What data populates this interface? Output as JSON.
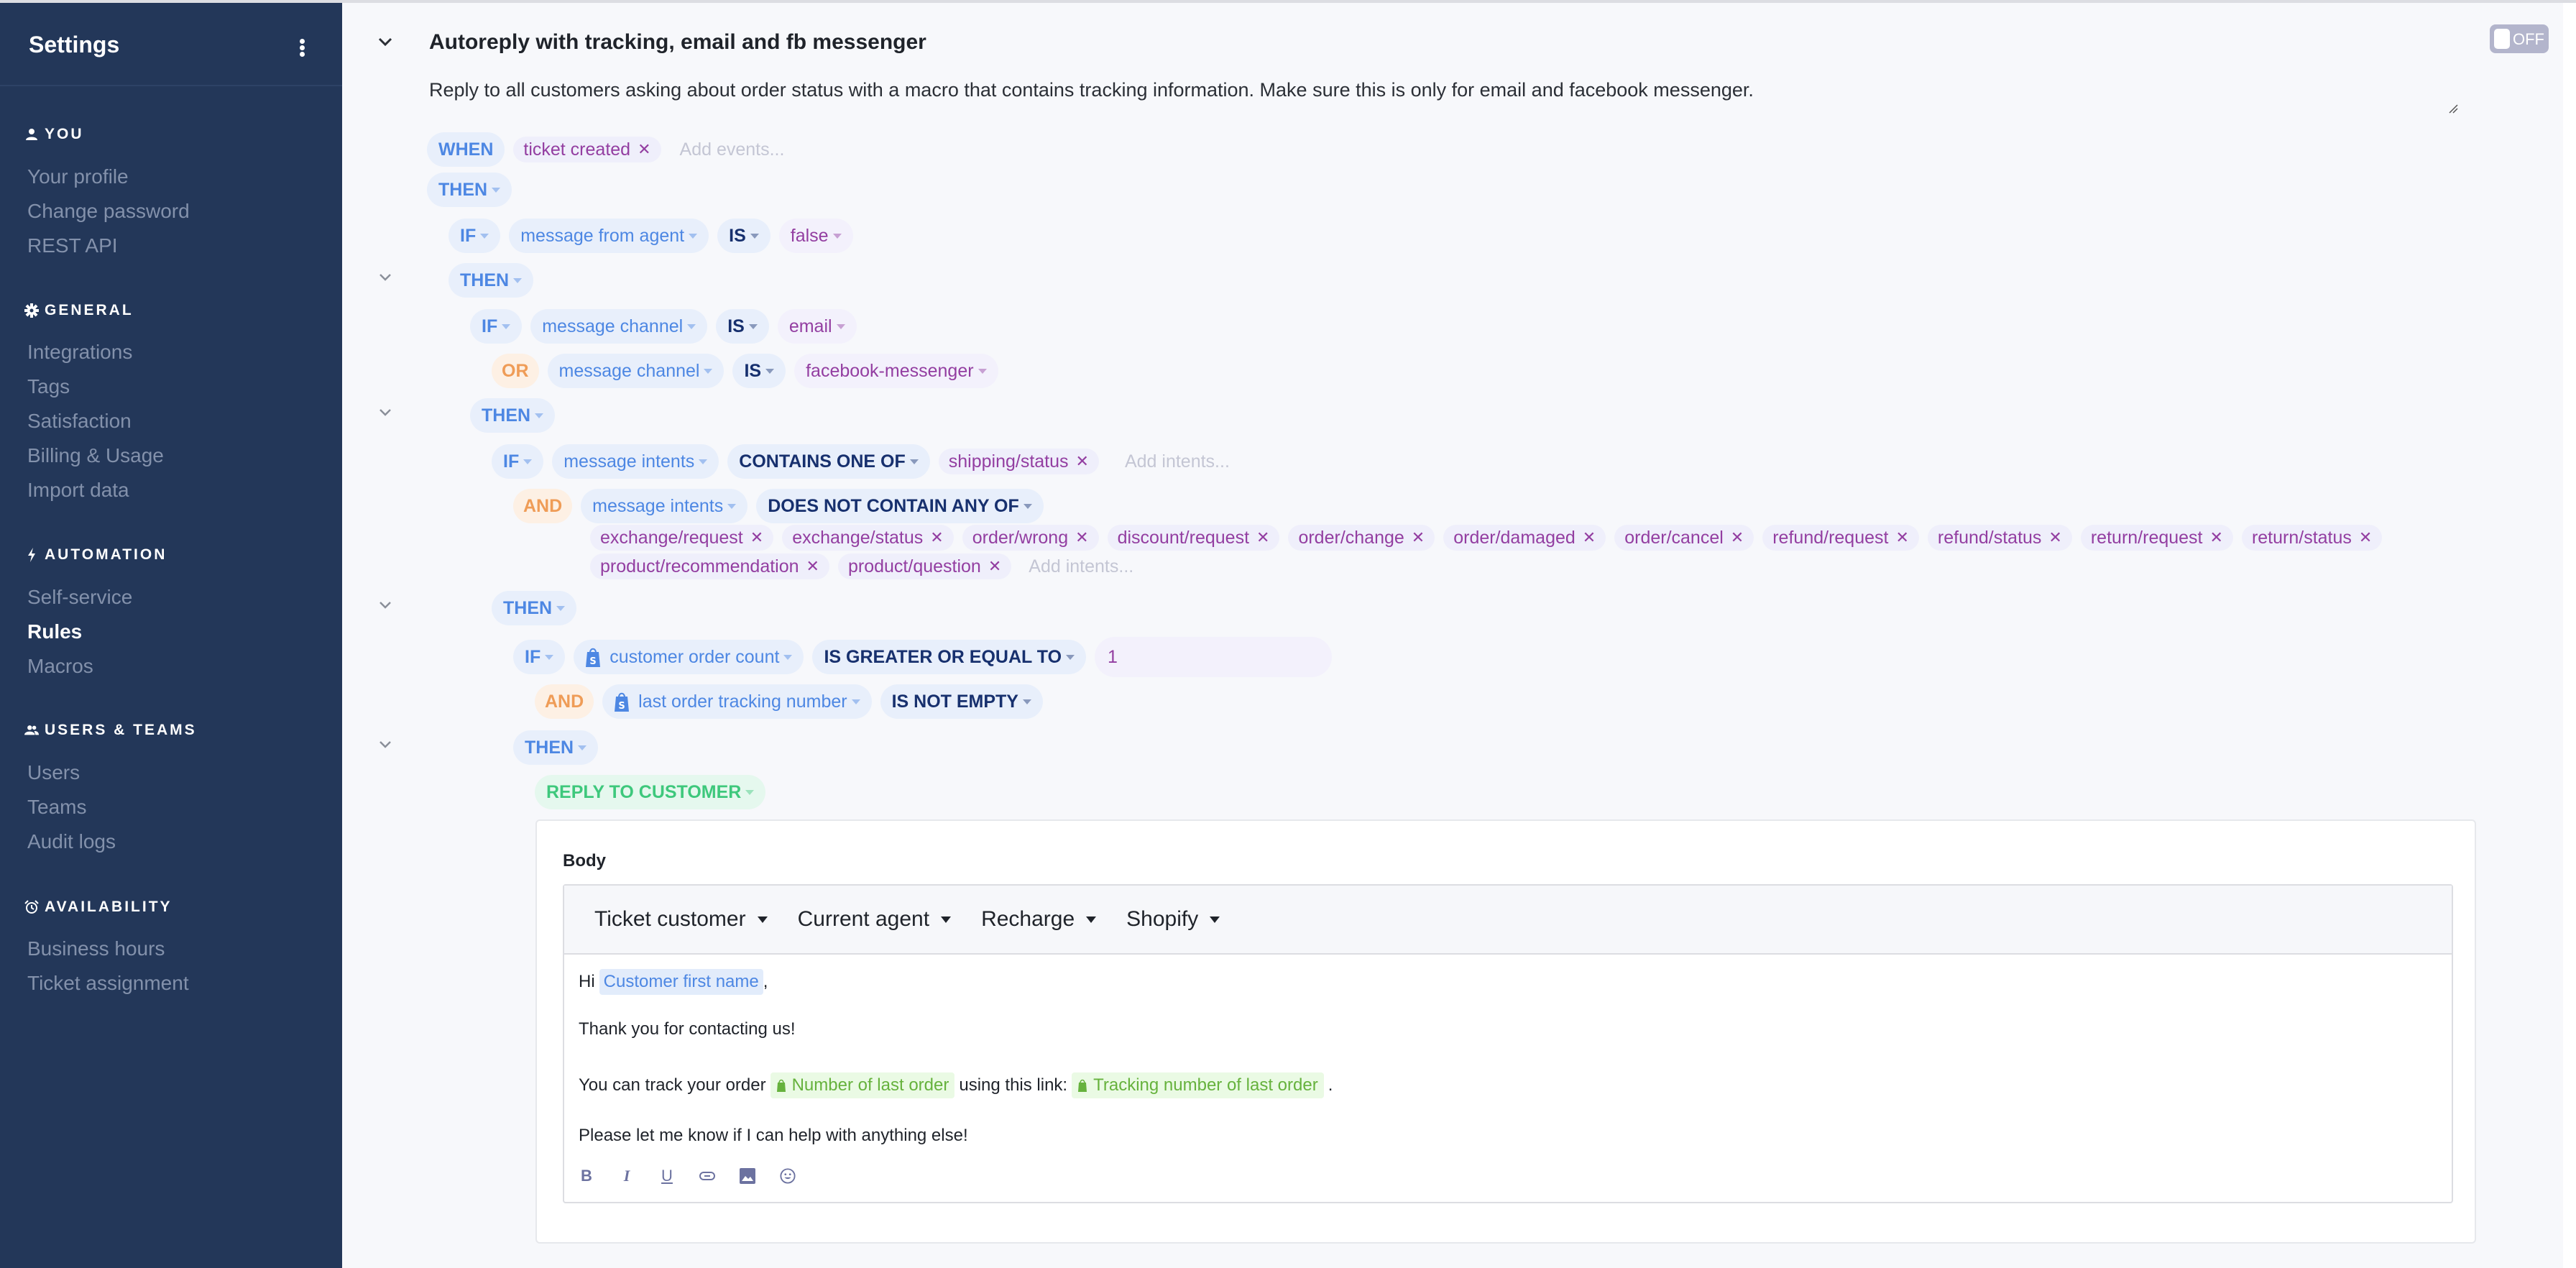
{
  "sidebar": {
    "title": "Settings",
    "menu_icon": "kebab-menu-icon",
    "sections": [
      {
        "heading": "YOU",
        "icon": "user-icon",
        "items": [
          {
            "label": "Your profile",
            "active": false
          },
          {
            "label": "Change password",
            "active": false
          },
          {
            "label": "REST API",
            "active": false
          }
        ]
      },
      {
        "heading": "GENERAL",
        "icon": "gear-icon",
        "items": [
          {
            "label": "Integrations",
            "active": false
          },
          {
            "label": "Tags",
            "active": false
          },
          {
            "label": "Satisfaction",
            "active": false
          },
          {
            "label": "Billing & Usage",
            "active": false
          },
          {
            "label": "Import data",
            "active": false
          }
        ]
      },
      {
        "heading": "AUTOMATION",
        "icon": "lightning-icon",
        "items": [
          {
            "label": "Self-service",
            "active": false
          },
          {
            "label": "Rules",
            "active": true
          },
          {
            "label": "Macros",
            "active": false
          }
        ]
      },
      {
        "heading": "USERS & TEAMS",
        "icon": "users-icon",
        "items": [
          {
            "label": "Users",
            "active": false
          },
          {
            "label": "Teams",
            "active": false
          },
          {
            "label": "Audit logs",
            "active": false
          }
        ]
      },
      {
        "heading": "AVAILABILITY",
        "icon": "alarm-clock-icon",
        "items": [
          {
            "label": "Business hours",
            "active": false
          },
          {
            "label": "Ticket assignment",
            "active": false
          }
        ]
      }
    ]
  },
  "rule": {
    "title": "Autoreply with tracking, email and fb messenger",
    "description": "Reply to all customers asking about order status with a macro that contains tracking information. Make sure this is only for email and facebook messenger.",
    "toggle_label": "OFF",
    "toggle_on": false,
    "when": {
      "keyword": "WHEN",
      "events": [
        "ticket created"
      ],
      "add_placeholder": "Add events..."
    },
    "then1": "THEN",
    "cond1": {
      "kw": "IF",
      "field": "message from agent",
      "op": "IS",
      "value": "false"
    },
    "then2": "THEN",
    "cond2": {
      "kw": "IF",
      "field": "message channel",
      "op": "IS",
      "value": "email"
    },
    "cond2b": {
      "kw": "OR",
      "field": "message channel",
      "op": "IS",
      "value": "facebook-messenger"
    },
    "then3": "THEN",
    "cond3": {
      "kw": "IF",
      "field": "message intents",
      "op": "CONTAINS ONE OF",
      "tags": [
        "shipping/status"
      ],
      "add_placeholder": "Add intents..."
    },
    "cond3b": {
      "kw": "AND",
      "field": "message intents",
      "op": "DOES NOT CONTAIN ANY OF",
      "tags": [
        "exchange/request",
        "exchange/status",
        "order/wrong",
        "discount/request",
        "order/change",
        "order/damaged",
        "order/cancel",
        "refund/request",
        "refund/status",
        "return/request",
        "return/status",
        "product/recommendation",
        "product/question"
      ],
      "add_placeholder": "Add intents..."
    },
    "then4": "THEN",
    "cond4": {
      "kw": "IF",
      "field": "customer order count",
      "op": "IS GREATER OR EQUAL TO",
      "value": "1"
    },
    "cond4b": {
      "kw": "AND",
      "field": "last order tracking number",
      "op": "IS NOT EMPTY"
    },
    "then5": "THEN",
    "action": "REPLY TO CUSTOMER",
    "body": {
      "label": "Body",
      "variable_menus": [
        "Ticket customer",
        "Current agent",
        "Recharge",
        "Shopify"
      ],
      "line1_prefix": "Hi",
      "line1_var": "Customer first name",
      "line1_suffix": ",",
      "line2": "Thank you for contacting us!",
      "line3_prefix": "You can track your order",
      "line3_var1": "Number of last order",
      "line3_mid": "using this link:",
      "line3_var2": "Tracking number of last order",
      "line3_suffix": ".",
      "line4": "Please let me know if I can help with anything else!",
      "format_tools": [
        "bold-icon",
        "italic-icon",
        "underline-icon",
        "link-icon",
        "image-icon",
        "emoji-icon"
      ]
    }
  },
  "colors": {
    "sidebar_bg": "#233759",
    "keyword_blue": "#4d87e3",
    "operator_navy": "#17306e",
    "value_purple": "#933ea1",
    "or_and_orange": "#ef9c57",
    "action_green": "#3ec87c",
    "shopify_green": "#66b23d"
  }
}
